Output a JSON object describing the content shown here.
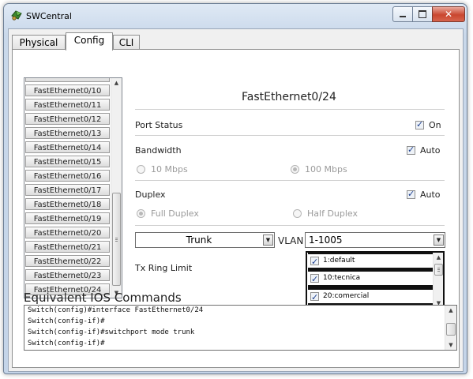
{
  "window": {
    "title": "SWCentral"
  },
  "tabs": [
    {
      "label": "Physical"
    },
    {
      "label": "Config",
      "active": true
    },
    {
      "label": "CLI"
    }
  ],
  "port_list": {
    "items": [
      "FastEthernet0/10",
      "FastEthernet0/11",
      "FastEthernet0/12",
      "FastEthernet0/13",
      "FastEthernet0/14",
      "FastEthernet0/15",
      "FastEthernet0/16",
      "FastEthernet0/17",
      "FastEthernet0/18",
      "FastEthernet0/19",
      "FastEthernet0/20",
      "FastEthernet0/21",
      "FastEthernet0/22",
      "FastEthernet0/23",
      "FastEthernet0/24"
    ]
  },
  "interface": {
    "name": "FastEthernet0/24",
    "port_status": {
      "label": "Port Status",
      "checkbox_label": "On",
      "checked": true
    },
    "bandwidth": {
      "label": "Bandwidth",
      "auto_label": "Auto",
      "auto_checked": true,
      "option_10": "10 Mbps",
      "option_100": "100 Mbps",
      "selected": "100 Mbps"
    },
    "duplex": {
      "label": "Duplex",
      "auto_label": "Auto",
      "auto_checked": true,
      "option_full": "Full Duplex",
      "option_half": "Half Duplex",
      "selected": "Full Duplex"
    },
    "mode": {
      "value": "Trunk"
    },
    "vlan": {
      "label": "VLAN",
      "value": "1-1005",
      "items": [
        {
          "label": "1:default",
          "checked": true
        },
        {
          "label": "10:tecnica",
          "checked": true
        },
        {
          "label": "20:comercial",
          "checked": true
        }
      ]
    },
    "tx_ring_limit": {
      "label": "Tx Ring Limit"
    }
  },
  "ios": {
    "label": "Equivalent IOS Commands",
    "lines": [
      "Switch(config)#interface FastEthernet0/24",
      "Switch(config-if)#",
      "Switch(config-if)#switchport mode trunk",
      "Switch(config-if)#"
    ]
  }
}
